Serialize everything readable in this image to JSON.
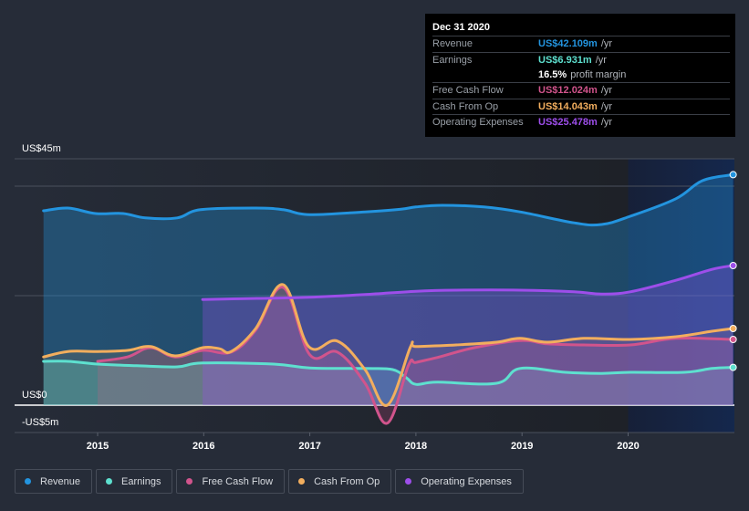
{
  "tooltip": {
    "date": "Dec 31 2020",
    "rows": [
      {
        "label": "Revenue",
        "value": "US$42.109m",
        "unit": "/yr",
        "color": "#2394df"
      },
      {
        "label": "Earnings",
        "value": "US$6.931m",
        "unit": "/yr",
        "color": "#5ee0cf"
      },
      {
        "label": "",
        "value": "16.5%",
        "unit": "profit margin",
        "color": "#ffffff"
      },
      {
        "label": "Free Cash Flow",
        "value": "US$12.024m",
        "unit": "/yr",
        "color": "#d1548c"
      },
      {
        "label": "Cash From Op",
        "value": "US$14.043m",
        "unit": "/yr",
        "color": "#f2ae5e"
      },
      {
        "label": "Operating Expenses",
        "value": "US$25.478m",
        "unit": "/yr",
        "color": "#9d4eea"
      }
    ]
  },
  "legend": [
    {
      "label": "Revenue",
      "color": "#2394df"
    },
    {
      "label": "Earnings",
      "color": "#5ee0cf"
    },
    {
      "label": "Free Cash Flow",
      "color": "#d1548c"
    },
    {
      "label": "Cash From Op",
      "color": "#f2ae5e"
    },
    {
      "label": "Operating Expenses",
      "color": "#9d4eea"
    }
  ],
  "chart_data": {
    "type": "area",
    "title": "",
    "xlabel": "",
    "ylabel": "",
    "y_tick_labels": [
      {
        "value": 45,
        "label": "US$45m"
      },
      {
        "value": 0,
        "label": "US$0"
      },
      {
        "value": -5,
        "label": "-US$5m"
      }
    ],
    "gridlines": [
      45,
      40,
      20,
      0,
      -5
    ],
    "ylim": [
      -5,
      45
    ],
    "xlim": [
      2014.5,
      2020.99
    ],
    "x_ticks": [
      2015,
      2016,
      2017,
      2018,
      2019,
      2020
    ],
    "highlight_from": 2020.0,
    "grid": true,
    "legend_position": "bottom-left",
    "series": [
      {
        "name": "Revenue",
        "color": "#2394df",
        "points": [
          [
            2014.49,
            35.5
          ],
          [
            2014.72,
            36.0
          ],
          [
            2014.98,
            35.0
          ],
          [
            2015.24,
            35.0
          ],
          [
            2015.45,
            34.2
          ],
          [
            2015.75,
            34.2
          ],
          [
            2015.97,
            35.7
          ],
          [
            2016.49,
            36.0
          ],
          [
            2016.75,
            35.7
          ],
          [
            2017.0,
            34.8
          ],
          [
            2017.52,
            35.3
          ],
          [
            2017.86,
            35.8
          ],
          [
            2018.0,
            36.2
          ],
          [
            2018.25,
            36.5
          ],
          [
            2018.64,
            36.2
          ],
          [
            2018.98,
            35.3
          ],
          [
            2019.49,
            33.3
          ],
          [
            2019.75,
            33.0
          ],
          [
            2020.02,
            34.5
          ],
          [
            2020.45,
            37.7
          ],
          [
            2020.7,
            41.0
          ],
          [
            2020.99,
            42.1
          ]
        ]
      },
      {
        "name": "Earnings",
        "color": "#5ee0cf",
        "points": [
          [
            2014.49,
            8.0
          ],
          [
            2014.72,
            8.0
          ],
          [
            2015.0,
            7.5
          ],
          [
            2015.37,
            7.2
          ],
          [
            2015.75,
            7.0
          ],
          [
            2015.99,
            7.7
          ],
          [
            2016.66,
            7.5
          ],
          [
            2017.0,
            6.8
          ],
          [
            2017.52,
            6.7
          ],
          [
            2017.78,
            6.5
          ],
          [
            2017.91,
            5.0
          ],
          [
            2018.0,
            3.8
          ],
          [
            2018.2,
            4.2
          ],
          [
            2018.76,
            4.0
          ],
          [
            2018.98,
            6.7
          ],
          [
            2019.41,
            6.0
          ],
          [
            2019.75,
            5.8
          ],
          [
            2020.02,
            6.0
          ],
          [
            2020.53,
            6.0
          ],
          [
            2020.79,
            6.7
          ],
          [
            2020.99,
            6.9
          ]
        ]
      },
      {
        "name": "Free Cash Flow",
        "color": "#d1548c",
        "points": [
          [
            2015.0,
            8.0
          ],
          [
            2015.28,
            8.8
          ],
          [
            2015.5,
            10.5
          ],
          [
            2015.73,
            8.8
          ],
          [
            2015.99,
            10.0
          ],
          [
            2016.26,
            9.7
          ],
          [
            2016.49,
            13.7
          ],
          [
            2016.75,
            21.5
          ],
          [
            2017.0,
            9.2
          ],
          [
            2017.26,
            9.7
          ],
          [
            2017.52,
            4.0
          ],
          [
            2017.73,
            -3.3
          ],
          [
            2017.93,
            7.3
          ],
          [
            2018.0,
            7.8
          ],
          [
            2018.2,
            8.7
          ],
          [
            2018.55,
            10.5
          ],
          [
            2018.98,
            11.8
          ],
          [
            2019.24,
            11.2
          ],
          [
            2019.58,
            11.0
          ],
          [
            2020.02,
            11.0
          ],
          [
            2020.45,
            12.2
          ],
          [
            2020.99,
            12.0
          ]
        ]
      },
      {
        "name": "Cash From Op",
        "color": "#f2ae5e",
        "points": [
          [
            2014.49,
            8.8
          ],
          [
            2014.72,
            9.8
          ],
          [
            2015.0,
            9.8
          ],
          [
            2015.28,
            10.0
          ],
          [
            2015.5,
            10.7
          ],
          [
            2015.73,
            9.0
          ],
          [
            2015.99,
            10.5
          ],
          [
            2016.15,
            10.3
          ],
          [
            2016.26,
            9.8
          ],
          [
            2016.49,
            14.0
          ],
          [
            2016.75,
            22.0
          ],
          [
            2016.99,
            10.7
          ],
          [
            2017.26,
            11.7
          ],
          [
            2017.52,
            6.5
          ],
          [
            2017.73,
            0.0
          ],
          [
            2017.95,
            10.7
          ],
          [
            2018.0,
            10.7
          ],
          [
            2018.38,
            11.0
          ],
          [
            2018.76,
            11.5
          ],
          [
            2018.98,
            12.2
          ],
          [
            2019.24,
            11.5
          ],
          [
            2019.58,
            12.2
          ],
          [
            2020.02,
            12.0
          ],
          [
            2020.45,
            12.5
          ],
          [
            2020.79,
            13.5
          ],
          [
            2020.99,
            14.0
          ]
        ]
      },
      {
        "name": "Operating Expenses",
        "color": "#9d4eea",
        "points": [
          [
            2015.99,
            19.3
          ],
          [
            2016.5,
            19.5
          ],
          [
            2017.0,
            19.7
          ],
          [
            2017.52,
            20.2
          ],
          [
            2018.0,
            20.8
          ],
          [
            2018.38,
            21.0
          ],
          [
            2018.98,
            21.0
          ],
          [
            2019.49,
            20.7
          ],
          [
            2019.75,
            20.3
          ],
          [
            2020.02,
            20.7
          ],
          [
            2020.45,
            22.8
          ],
          [
            2020.79,
            24.8
          ],
          [
            2020.99,
            25.5
          ]
        ]
      }
    ]
  }
}
